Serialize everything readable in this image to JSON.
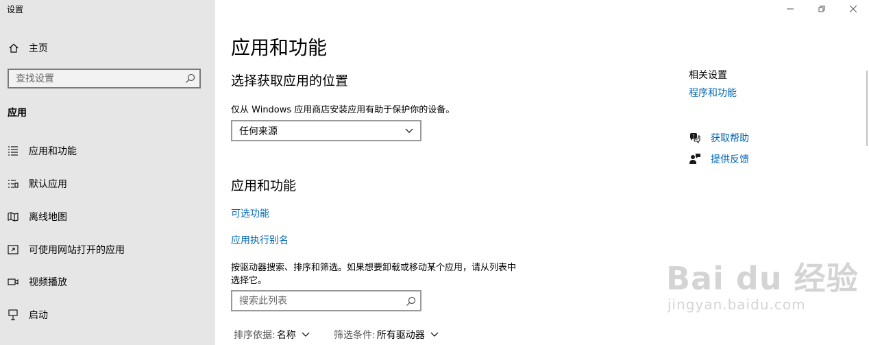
{
  "window": {
    "title": "设置",
    "controls": [
      "minimize",
      "restore",
      "close"
    ]
  },
  "sidebar": {
    "home_label": "主页",
    "search_placeholder": "查找设置",
    "section_label": "应用",
    "items": [
      {
        "label": "应用和功能",
        "icon": "apps-features-icon"
      },
      {
        "label": "默认应用",
        "icon": "default-apps-icon"
      },
      {
        "label": "离线地图",
        "icon": "offline-maps-icon"
      },
      {
        "label": "可使用网站打开的应用",
        "icon": "apps-for-websites-icon"
      },
      {
        "label": "视频播放",
        "icon": "video-playback-icon"
      },
      {
        "label": "启动",
        "icon": "startup-icon"
      }
    ]
  },
  "main": {
    "title": "应用和功能",
    "install_section": {
      "heading": "选择获取应用的位置",
      "description": "仅从 Windows 应用商店安装应用有助于保护你的设备。",
      "dropdown_value": "任何来源"
    },
    "apps_section": {
      "heading": "应用和功能",
      "optional_features_link": "可选功能",
      "app_alias_link": "应用执行别名",
      "description_line1": "按驱动器搜索、排序和筛选。如果想要卸载或移动某个应用，请从列表中",
      "description_line2": "选择它。",
      "search_placeholder": "搜索此列表",
      "sort_key": "排序依据:",
      "sort_value": "名称",
      "filter_key": "筛选条件:",
      "filter_value": "所有驱动器"
    }
  },
  "related": {
    "title": "相关设置",
    "programs_link": "程序和功能",
    "get_help": "获取帮助",
    "give_feedback": "提供反馈"
  },
  "watermark": {
    "main": "Bai du 经验",
    "sub": "jingyan.baidu.com"
  },
  "colors": {
    "sidebar_bg": "#e6e6e6",
    "link": "#0066b4"
  }
}
